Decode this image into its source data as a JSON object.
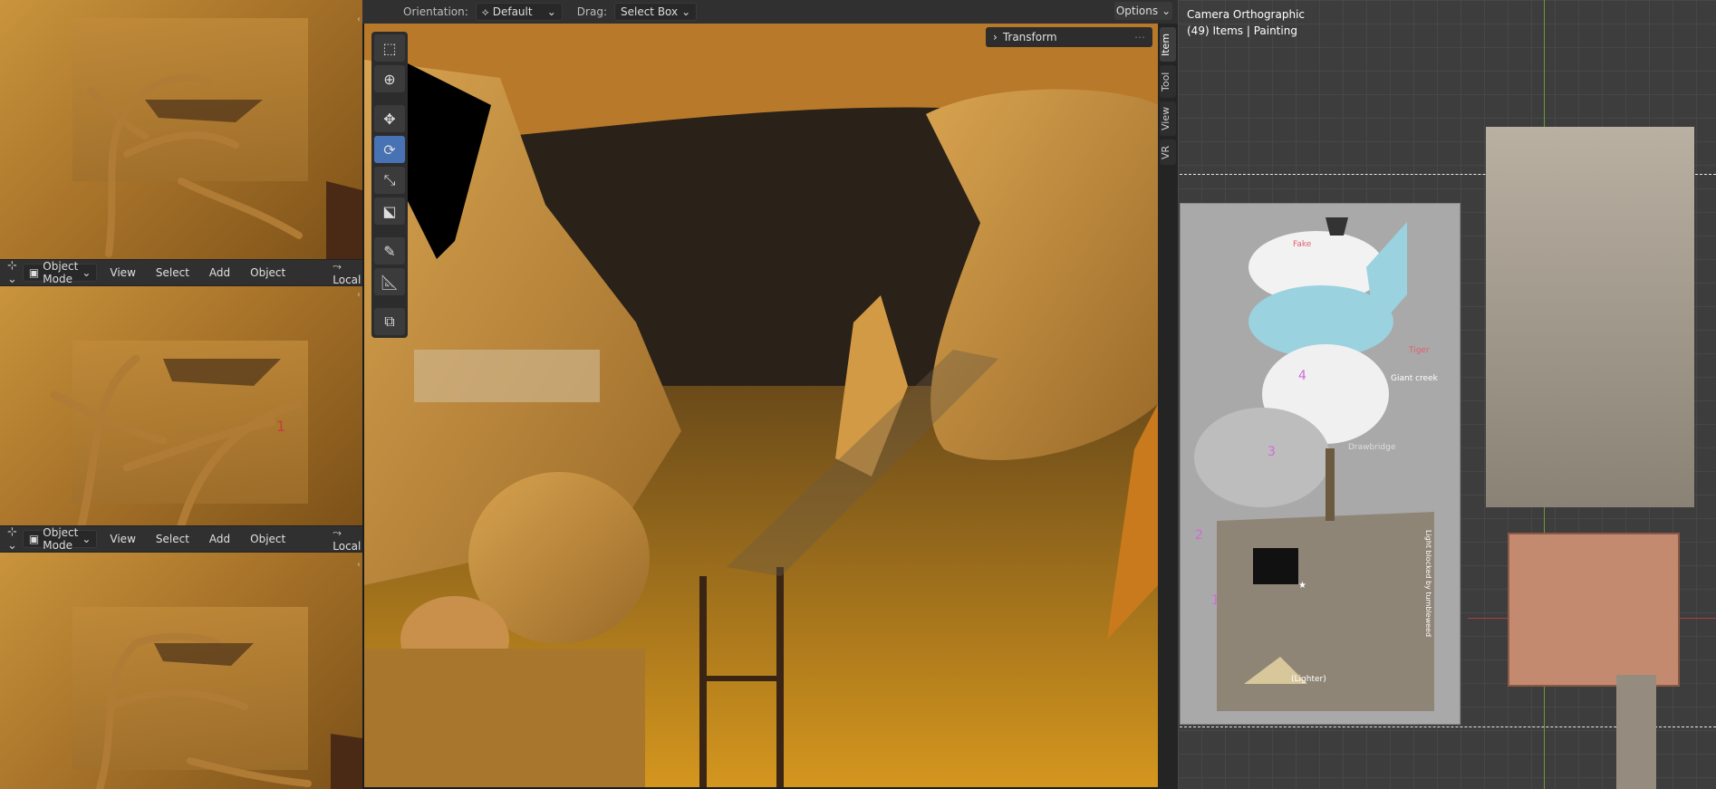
{
  "left_panel": {
    "header1": {
      "mode": "Object Mode",
      "menus": [
        "View",
        "Select",
        "Add",
        "Object"
      ],
      "transform_orientation": "Local"
    },
    "header2": {
      "mode": "Object Mode",
      "menus": [
        "View",
        "Select",
        "Add",
        "Object"
      ],
      "transform_orientation": "Local"
    }
  },
  "main_header": {
    "orientation_label": "Orientation:",
    "orientation_value": "Default",
    "drag_label": "Drag:",
    "drag_value": "Select Box",
    "options_label": "Options"
  },
  "toolbar": {
    "tools": [
      "select-box",
      "cursor",
      "move",
      "rotate",
      "scale",
      "transform",
      "annotate",
      "measure",
      "add-cube"
    ],
    "active": "rotate"
  },
  "transform_panel": {
    "label": "Transform"
  },
  "side_tabs": [
    "Item",
    "Tool",
    "View",
    "VR"
  ],
  "camera_info": {
    "title": "Camera Orthographic",
    "subtitle": "(49) Items | Painting"
  },
  "painting_labels": {
    "fake": "Fake",
    "tiger": "Tiger",
    "giant_creek": "Giant creek",
    "drawbridge": "Drawbridge",
    "lighter": "(Lighter)",
    "light_blocked": "Light blocked by tumbleweed",
    "numbers": [
      "4",
      "3",
      "2",
      "1"
    ]
  },
  "colors": {
    "active_tool": "#4772b3",
    "header_bg": "#303030",
    "number_pink": "#d36ad6"
  }
}
